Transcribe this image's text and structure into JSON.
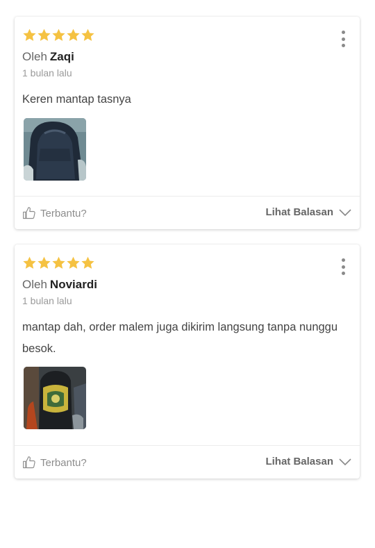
{
  "reviews": [
    {
      "rating": 5,
      "by_label": "Oleh",
      "author": "Zaqi",
      "time": "1 bulan lalu",
      "text": "Keren mantap tasnya",
      "photo": "photo of a dark blue backpack",
      "helpful_label": "Terbantu?",
      "replies_label": "Lihat Balasan"
    },
    {
      "rating": 5,
      "by_label": "Oleh",
      "author": "Noviardi",
      "time": "1 bulan lalu",
      "text": "mantap dah, order malem juga dikirim langsung tanpa nunggu besok.",
      "photo": "photo of a black backpack with yellow and green print",
      "helpful_label": "Terbantu?",
      "replies_label": "Lihat Balasan"
    }
  ],
  "colors": {
    "star": "#F5C242",
    "divider": "#ececec",
    "muted": "#8c8c8c"
  },
  "icons": [
    "star-icon",
    "more-vertical-icon",
    "thumbs-up-icon",
    "chevron-down-icon"
  ]
}
